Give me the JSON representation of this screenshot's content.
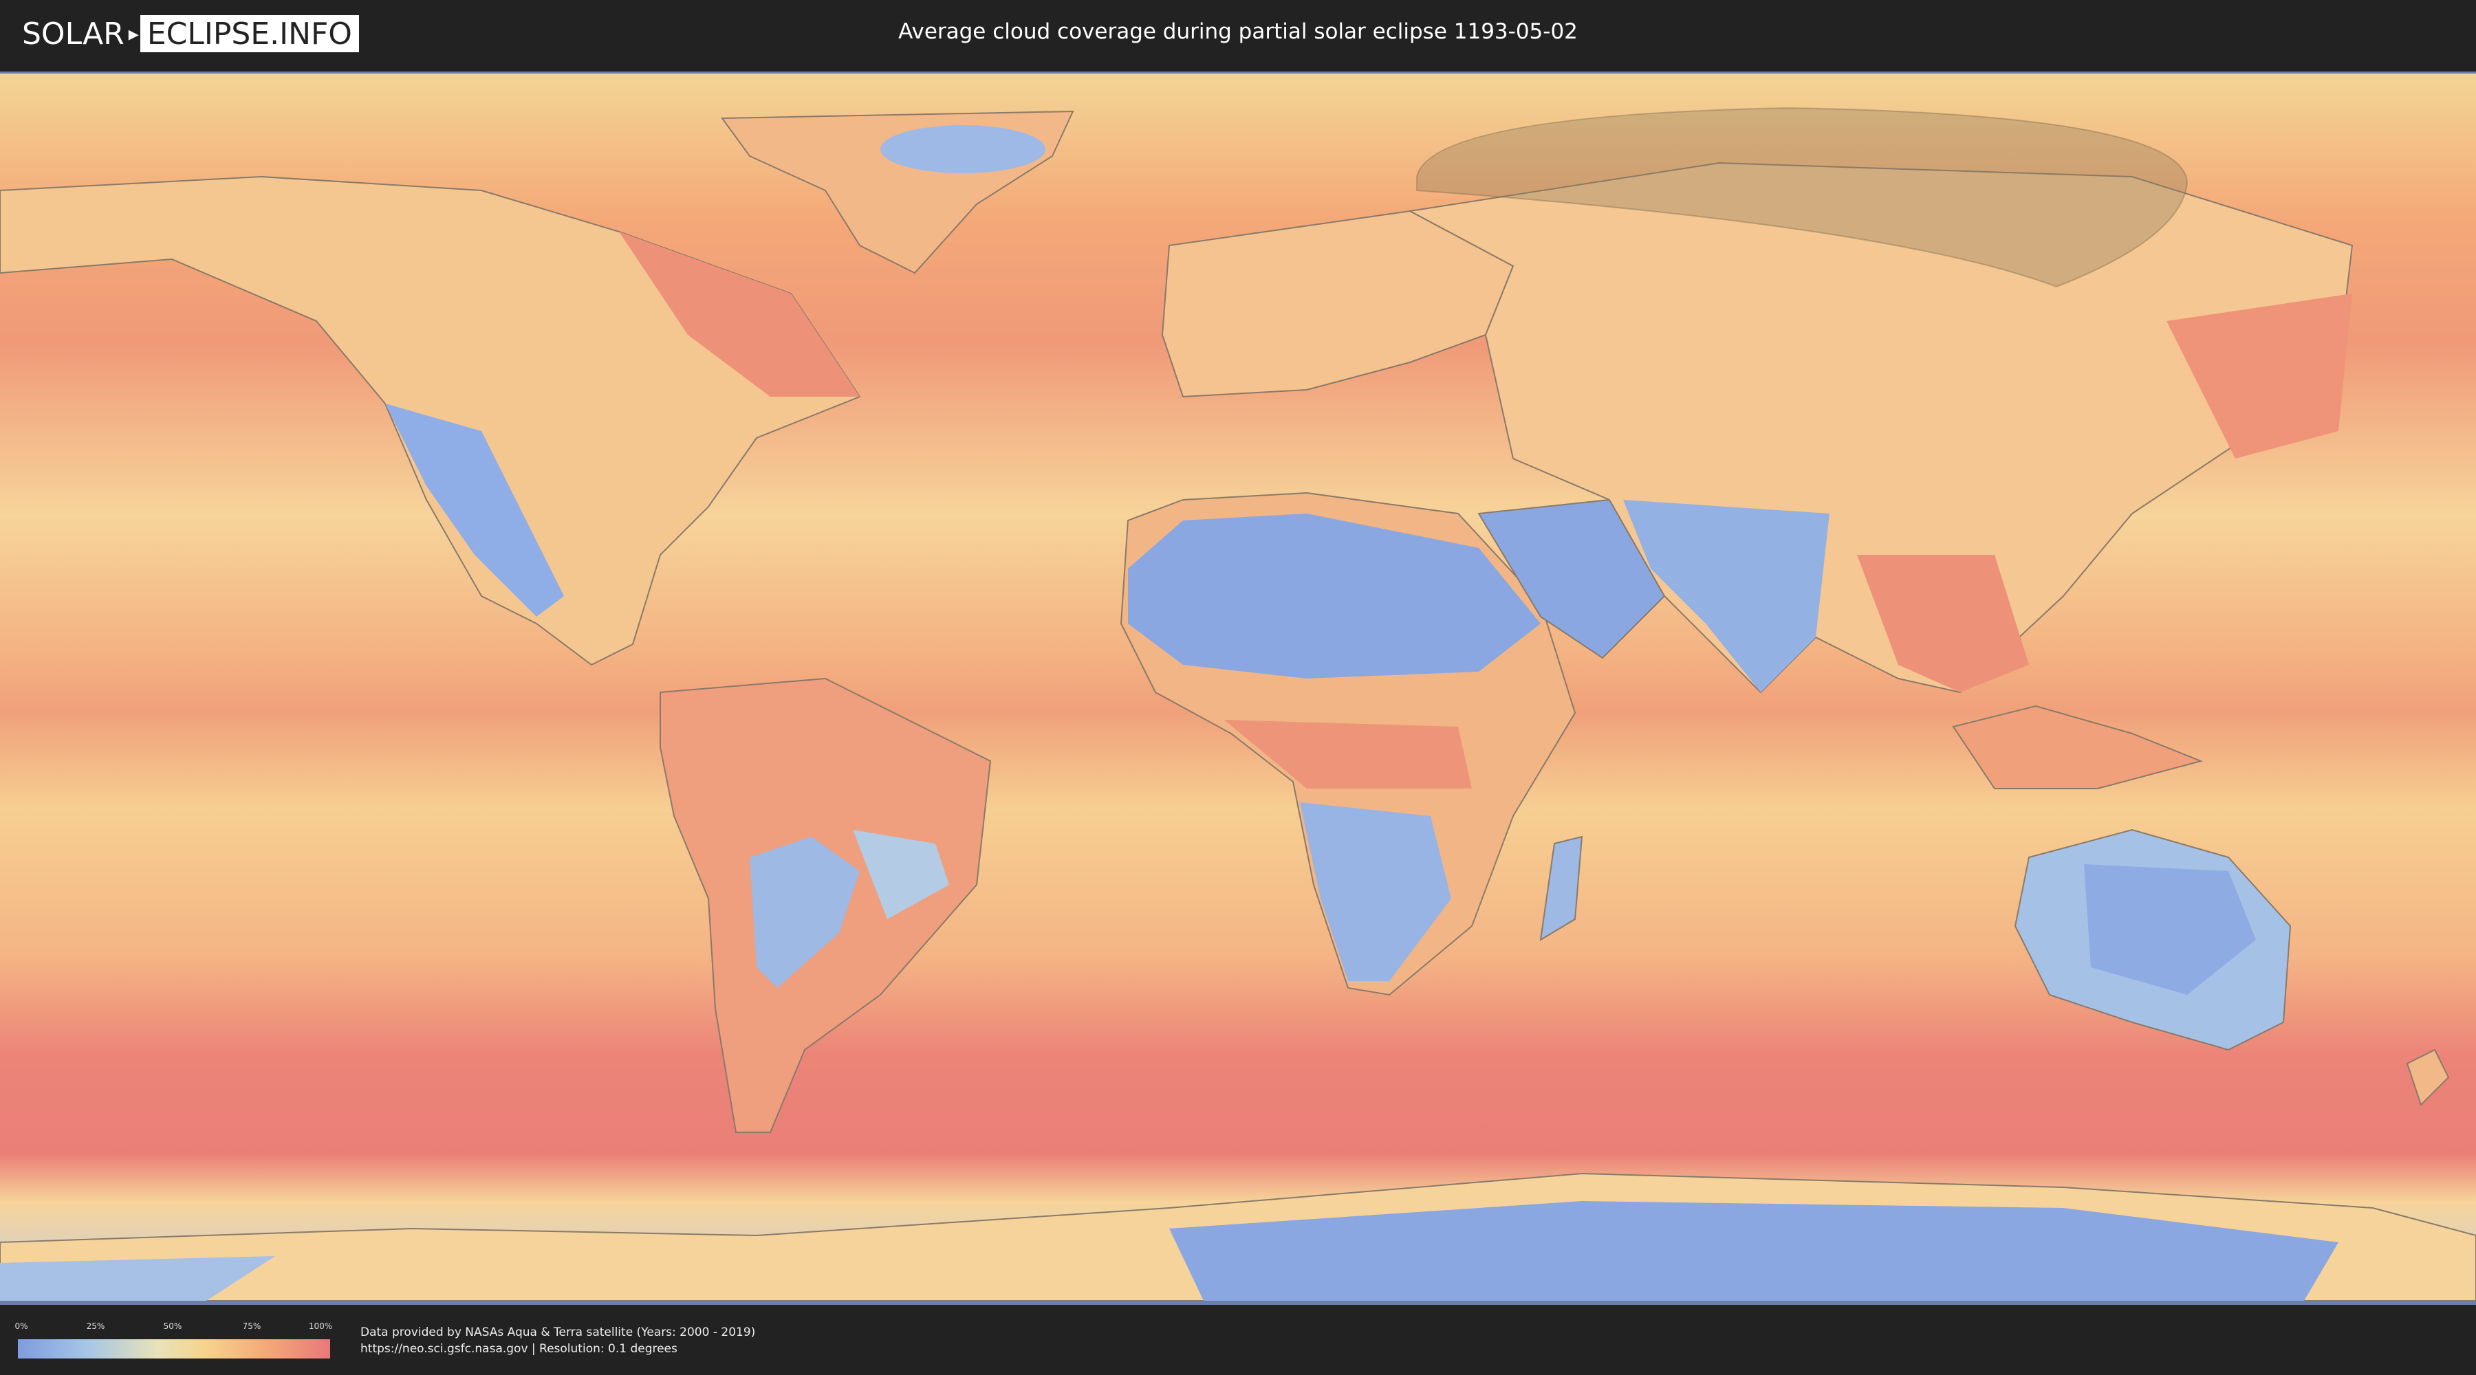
{
  "header": {
    "logo_part1": "SOLAR",
    "logo_part2": "ECLIPSE.INFO",
    "title": "Average cloud coverage during partial solar eclipse 1193-05-02"
  },
  "legend": {
    "ticks": [
      "0%",
      "25%",
      "50%",
      "75%",
      "100%"
    ],
    "tick_positions": [
      0,
      0.25,
      0.5,
      0.75,
      1.0
    ],
    "colors": [
      "#7f9be0",
      "#a6c5e6",
      "#e8e3b8",
      "#f6d38c",
      "#f4a877",
      "#e8787a"
    ]
  },
  "footer": {
    "credit_line1": "Data provided by NASAs Aqua & Terra satellite (Years: 2000 - 2019)",
    "credit_line2": "https://neo.sci.gsfc.nasa.gov | Resolution: 0.1 degrees"
  },
  "map": {
    "projection": "equirectangular",
    "eclipse_region": "partial-visibility shading over northern Asia / Arctic",
    "colors": {
      "clear": "#8aa7e2",
      "low": "#b6cde6",
      "mid": "#f3d596",
      "high": "#f4a878",
      "overcast": "#e67c77",
      "eclipse_shadow": "#8c7a5a",
      "coastline": "#8a7a6a"
    }
  }
}
